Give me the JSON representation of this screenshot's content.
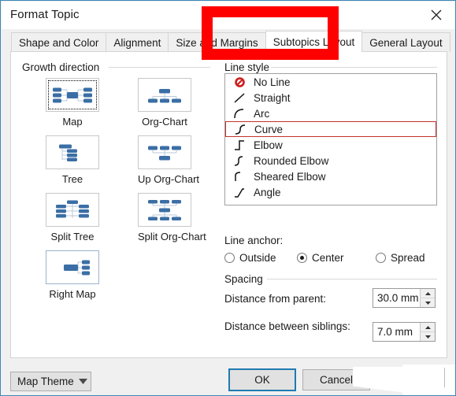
{
  "window": {
    "title": "Format Topic",
    "close_icon": "close-icon"
  },
  "tabs": [
    {
      "label": "Shape and Color",
      "active": false
    },
    {
      "label": "Alignment",
      "active": false
    },
    {
      "label": "Size and Margins",
      "active": false
    },
    {
      "label": "Subtopics Layout",
      "active": true
    },
    {
      "label": "General Layout",
      "active": false
    }
  ],
  "growth_direction": {
    "group_label": "Growth direction",
    "items": [
      {
        "label": "Map",
        "icon": "map-layout-icon",
        "state": "selected"
      },
      {
        "label": "Org-Chart",
        "icon": "org-chart-layout-icon",
        "state": "normal"
      },
      {
        "label": "Tree",
        "icon": "tree-layout-icon",
        "state": "normal"
      },
      {
        "label": "Up Org-Chart",
        "icon": "up-org-chart-layout-icon",
        "state": "normal"
      },
      {
        "label": "Split Tree",
        "icon": "split-tree-layout-icon",
        "state": "normal"
      },
      {
        "label": "Split Org-Chart",
        "icon": "split-org-chart-layout-icon",
        "state": "normal"
      },
      {
        "label": "Right Map",
        "icon": "right-map-layout-icon",
        "state": "hover"
      }
    ]
  },
  "line_style": {
    "group_label": "Line style",
    "selected": "Curve",
    "items": [
      {
        "label": "No Line",
        "glyph": "no-line-icon"
      },
      {
        "label": "Straight",
        "glyph": "straight-line-icon"
      },
      {
        "label": "Arc",
        "glyph": "arc-line-icon"
      },
      {
        "label": "Curve",
        "glyph": "curve-line-icon"
      },
      {
        "label": "Elbow",
        "glyph": "elbow-line-icon"
      },
      {
        "label": "Rounded Elbow",
        "glyph": "rounded-elbow-line-icon"
      },
      {
        "label": "Sheared Elbow",
        "glyph": "sheared-elbow-line-icon"
      },
      {
        "label": "Angle",
        "glyph": "angle-line-icon"
      }
    ]
  },
  "line_anchor": {
    "label": "Line anchor:",
    "selected": "Center",
    "options": [
      {
        "label": "Outside",
        "checked": false
      },
      {
        "label": "Center",
        "checked": true
      },
      {
        "label": "Spread",
        "checked": false
      }
    ]
  },
  "spacing": {
    "group_label": "Spacing",
    "fields": [
      {
        "label": "Distance from parent:",
        "value": "30.0 mm"
      },
      {
        "label": "Distance between siblings:",
        "value": "7.0 mm"
      }
    ]
  },
  "footer": {
    "theme_button": "Map Theme",
    "ok_button": "OK",
    "cancel_button": "Cancel"
  },
  "annotation": {
    "shape": "rectangle",
    "color": "#fe0000",
    "targets": "Subtopics Layout"
  },
  "colors": {
    "accent_blue": "#3b6ea5",
    "dialog_border": "#3b88b8",
    "annotation_red": "#fe0000",
    "selection_red": "#c1342c",
    "default_button_border": "#1f7ab0"
  }
}
